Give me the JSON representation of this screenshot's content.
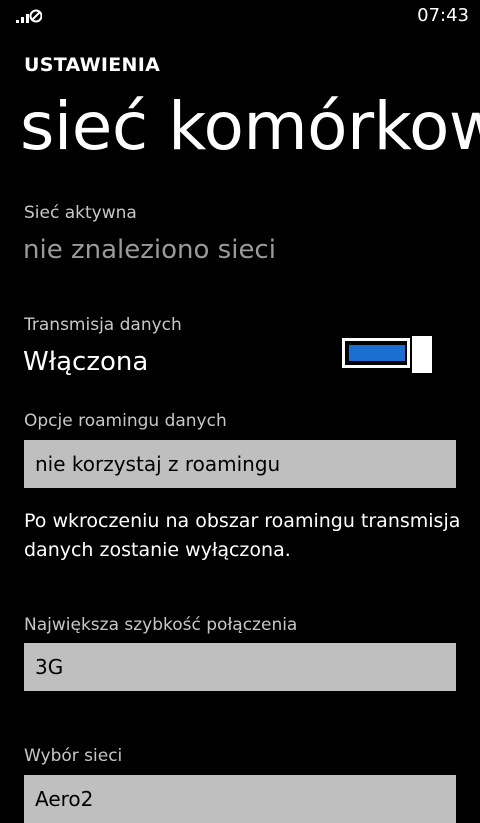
{
  "status_bar": {
    "signal_icon": "signal-no-sim-icon",
    "time": "07:43"
  },
  "header": {
    "app_title": "USTAWIENIA",
    "page_title": "sieć komórkow"
  },
  "active_network": {
    "label": "Sieć aktywna",
    "value": "nie znaleziono sieci"
  },
  "data_connection": {
    "label": "Transmisja danych",
    "value": "Włączona",
    "toggle_on": true,
    "accent_color": "#1b6fd1"
  },
  "roaming": {
    "label": "Opcje roamingu danych",
    "selected": "nie korzystaj z roamingu",
    "note": "Po wkroczeniu na obszar roamingu transmisja danych zostanie wyłączona."
  },
  "max_speed": {
    "label": "Największa szybkość połączenia",
    "selected": "3G"
  },
  "network_selection": {
    "label": "Wybór sieci",
    "selected": "Aero2"
  }
}
